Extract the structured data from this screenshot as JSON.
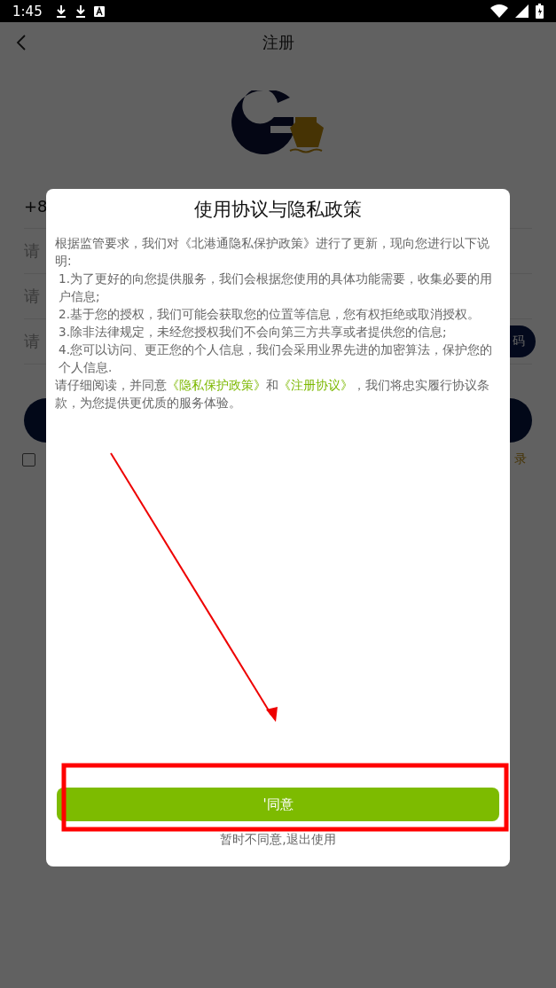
{
  "status_bar": {
    "time": "1:45"
  },
  "header": {
    "title": "注册"
  },
  "background_form": {
    "phone_prefix": "+8",
    "fields": [
      {
        "placeholder": "请"
      },
      {
        "placeholder": "请"
      },
      {
        "placeholder": "请"
      }
    ],
    "code_button": "码",
    "checkbox": {
      "checked": false
    },
    "login_link": "录"
  },
  "dialog": {
    "title": "使用协议与隐私政策",
    "paragraphs": [
      {
        "kind": "text",
        "segments": [
          {
            "text": "根据监管要求，我们对《北港通隐私保护政策》进行了更新，现向您进行以下说明:",
            "kind": "plain"
          }
        ]
      },
      {
        "kind": "item",
        "segments": [
          {
            "text": "1.为了更好的向您提供服务，我们会根据您使用的具体功能需要，收集必要的用户信息;",
            "kind": "plain"
          }
        ]
      },
      {
        "kind": "item",
        "segments": [
          {
            "text": "2.基于您的授权，我们可能会获取您的位置等信息，您有权拒绝或取消授权。",
            "kind": "plain"
          }
        ]
      },
      {
        "kind": "item",
        "segments": [
          {
            "text": "3.除非法律规定，未经您授权我们不会向第三方共享或者提供您的信息;",
            "kind": "plain"
          }
        ]
      },
      {
        "kind": "item",
        "segments": [
          {
            "text": "4.您可以访问、更正您的个人信息，我们会采用业界先进的加密算法，保护您的个人信息.",
            "kind": "plain"
          }
        ]
      },
      {
        "kind": "text",
        "segments": [
          {
            "text": "请仔细阅读，并同意",
            "kind": "plain"
          },
          {
            "text": "《隐私保护政策》",
            "kind": "link"
          },
          {
            "text": "和",
            "kind": "plain"
          },
          {
            "text": "《注册协议》",
            "kind": "link"
          },
          {
            "text": "，我们将忠实履行协议条款，为您提供更优质的服务体验。",
            "kind": "plain"
          }
        ]
      }
    ],
    "agree_button": "'同意",
    "decline_link": "暂时不同意,退出使用"
  }
}
